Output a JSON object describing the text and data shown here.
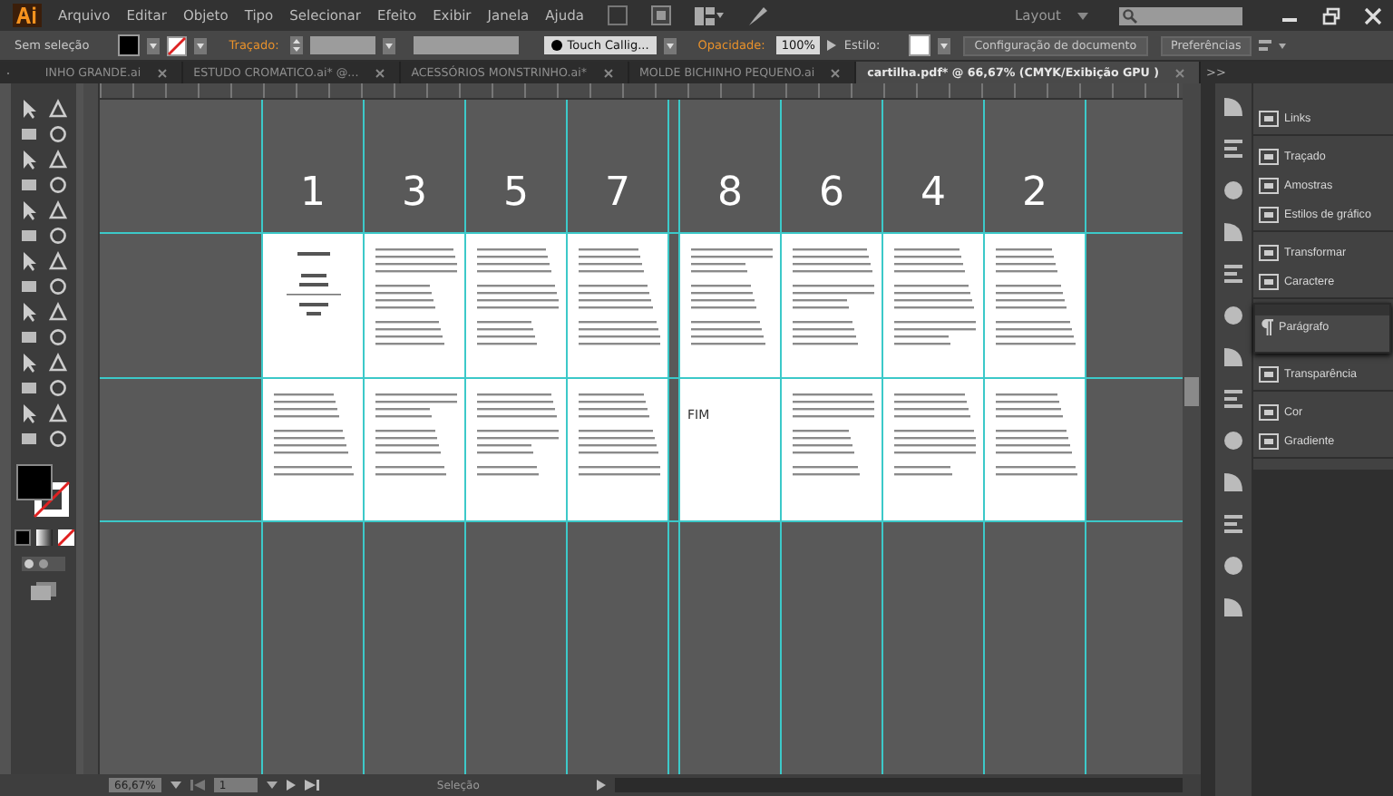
{
  "menu_bar": {
    "items": [
      "Arquivo",
      "Editar",
      "Objeto",
      "Tipo",
      "Selecionar",
      "Efeito",
      "Exibir",
      "Janela",
      "Ajuda"
    ],
    "workspace": "Layout"
  },
  "control_bar": {
    "selection": "Sem seleção",
    "stroke_label": "Traçado:",
    "brush": "Touch Callig...",
    "opacity_label": "Opacidade:",
    "opacity": "100%",
    "style_label": "Estilo:",
    "buttons": [
      "Configuração de documento",
      "Preferências"
    ]
  },
  "tabs": [
    {
      "label": "INHO GRANDE.ai",
      "selected": false
    },
    {
      "label": "ESTUDO CROMATICO.ai* @...",
      "selected": false
    },
    {
      "label": "ACESSÓRIOS MONSTRINHO.ai*",
      "selected": false
    },
    {
      "label": "MOLDE BICHINHO PEQUENO.ai",
      "selected": false
    },
    {
      "label": "cartilha.pdf* @ 66,67% (CMYK/Exibição GPU )",
      "selected": true
    }
  ],
  "tabs_overflow": ">>",
  "spreads": [
    {
      "pages": [
        {
          "number": "1",
          "kind": "cover"
        },
        {
          "number": "3",
          "kind": "text"
        },
        {
          "number": "5",
          "kind": "text"
        },
        {
          "number": "7",
          "kind": "text"
        }
      ]
    },
    {
      "pages": [
        {
          "number": "8",
          "kind": "text",
          "end_text": "FIM"
        },
        {
          "number": "6",
          "kind": "text"
        },
        {
          "number": "4",
          "kind": "text"
        },
        {
          "number": "2",
          "kind": "text"
        }
      ]
    }
  ],
  "panels": [
    {
      "label": "Links"
    },
    {
      "label": "Traçado"
    },
    {
      "label": "Amostras"
    },
    {
      "label": "Estilos de gráfico"
    },
    {
      "label": "Transformar"
    },
    {
      "label": "Caractere"
    },
    {
      "label": "Transparência"
    },
    {
      "label": "Cor"
    },
    {
      "label": "Gradiente"
    }
  ],
  "floating_panel": {
    "label": "Parágrafo"
  },
  "status_bar": {
    "zoom": "66,67%",
    "artboard": "1",
    "tool": "Seleção"
  }
}
